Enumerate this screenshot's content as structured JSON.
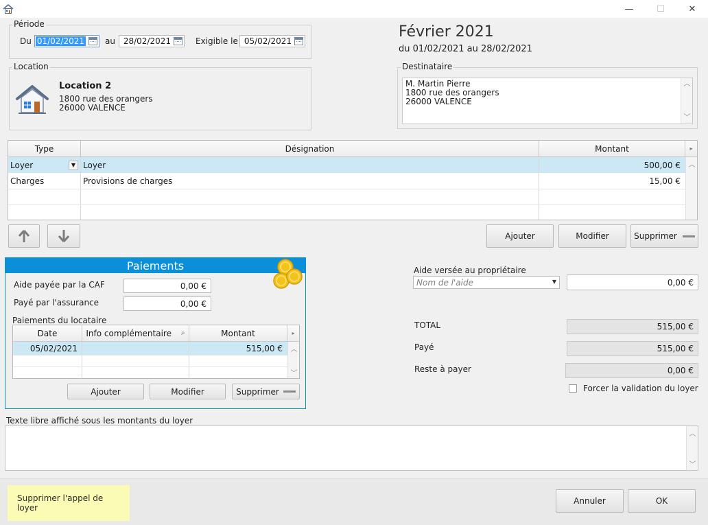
{
  "window": {
    "minimize": "—",
    "maximize": "☐",
    "close": "✕"
  },
  "periode": {
    "title": "Période",
    "du_label": "Du",
    "du_value": "01/02/2021",
    "au_label": "au",
    "au_value": "28/02/2021",
    "exigible_label": "Exigible le",
    "exigible_value": "05/02/2021"
  },
  "header": {
    "month": "Février 2021",
    "range": "du 01/02/2021 au 28/02/2021"
  },
  "location": {
    "title": "Location",
    "name": "Location 2",
    "address1": "1800 rue des orangers",
    "address2": "26000 VALENCE"
  },
  "destinataire": {
    "title": "Destinataire",
    "line1": "M. Martin Pierre",
    "line2": "1800 rue des orangers",
    "line3": "26000 VALENCE"
  },
  "lignes": {
    "columns": {
      "type": "Type",
      "designation": "Désignation",
      "montant": "Montant"
    },
    "rows": [
      {
        "type": "Loyer",
        "designation": "Loyer",
        "montant": "500,00 €"
      },
      {
        "type": "Charges",
        "designation": "Provisions de charges",
        "montant": "15,00 €"
      }
    ],
    "buttons": {
      "ajouter": "Ajouter",
      "modifier": "Modifier",
      "supprimer": "Supprimer"
    }
  },
  "paiements": {
    "title": "Paiements",
    "caf_label": "Aide payée par la CAF",
    "caf_value": "0,00 €",
    "assurance_label": "Payé par l'assurance",
    "assurance_value": "0,00 €",
    "locataire_label": "Paiements du locataire",
    "columns": {
      "date": "Date",
      "info": "Info complémentaire",
      "montant": "Montant"
    },
    "rows": [
      {
        "date": "05/02/2021",
        "info": "",
        "montant": "515,00 €"
      }
    ],
    "buttons": {
      "ajouter": "Ajouter",
      "modifier": "Modifier",
      "supprimer": "Supprimer"
    }
  },
  "aide": {
    "label": "Aide versée au propriétaire",
    "placeholder": "Nom de l'aide",
    "value": "0,00 €"
  },
  "totaux": {
    "total_label": "TOTAL",
    "total_value": "515,00 €",
    "paye_label": "Payé",
    "paye_value": "515,00 €",
    "reste_label": "Reste à payer",
    "reste_value": "0,00 €",
    "forcer_label": "Forcer la validation du loyer"
  },
  "texte_libre": {
    "label": "Texte libre affiché sous les montants du loyer",
    "value": ""
  },
  "footer": {
    "supprimer": "Supprimer l'appel de loyer",
    "annuler": "Annuler",
    "ok": "OK"
  },
  "colors": {
    "accent": "#0a8fd8",
    "selection": "#cce8f5",
    "highlight": "#fbfbb6"
  }
}
